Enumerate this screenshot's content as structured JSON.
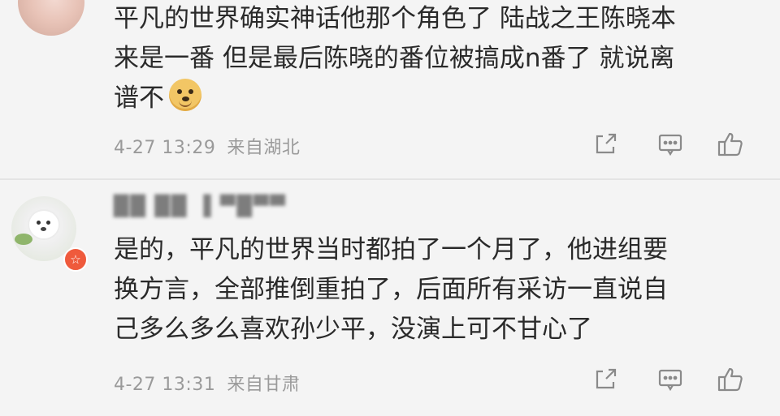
{
  "comments": [
    {
      "lines": [
        "平凡的世界确实神话他那个角色了 陆战之王陈晓本",
        "来是一番 但是最后陈晓的番位被搞成n番了 就说离",
        "谱不"
      ],
      "emoji": "doge-emoji",
      "date": "4-27 13:29",
      "location": "来自湖北",
      "actions": [
        "share-icon",
        "comment-icon",
        "like-icon"
      ]
    },
    {
      "username": "██ ██ ▐ ▀█▀▀",
      "lines": [
        "是的，平凡的世界当时都拍了一个月了，他进组要",
        "换方言，全部推倒重拍了，后面所有采访一直说自",
        "己多么多么喜欢孙少平，没演上可不甘心了"
      ],
      "badge": "☆",
      "date": "4-27 13:31",
      "location": "来自甘肃",
      "actions": [
        "share-icon",
        "comment-icon",
        "like-icon"
      ]
    }
  ],
  "colors": {
    "background": "#f4f4f4",
    "text": "#2a2a2a",
    "meta": "#9a9a9a",
    "badge": "#ef5a3c"
  }
}
